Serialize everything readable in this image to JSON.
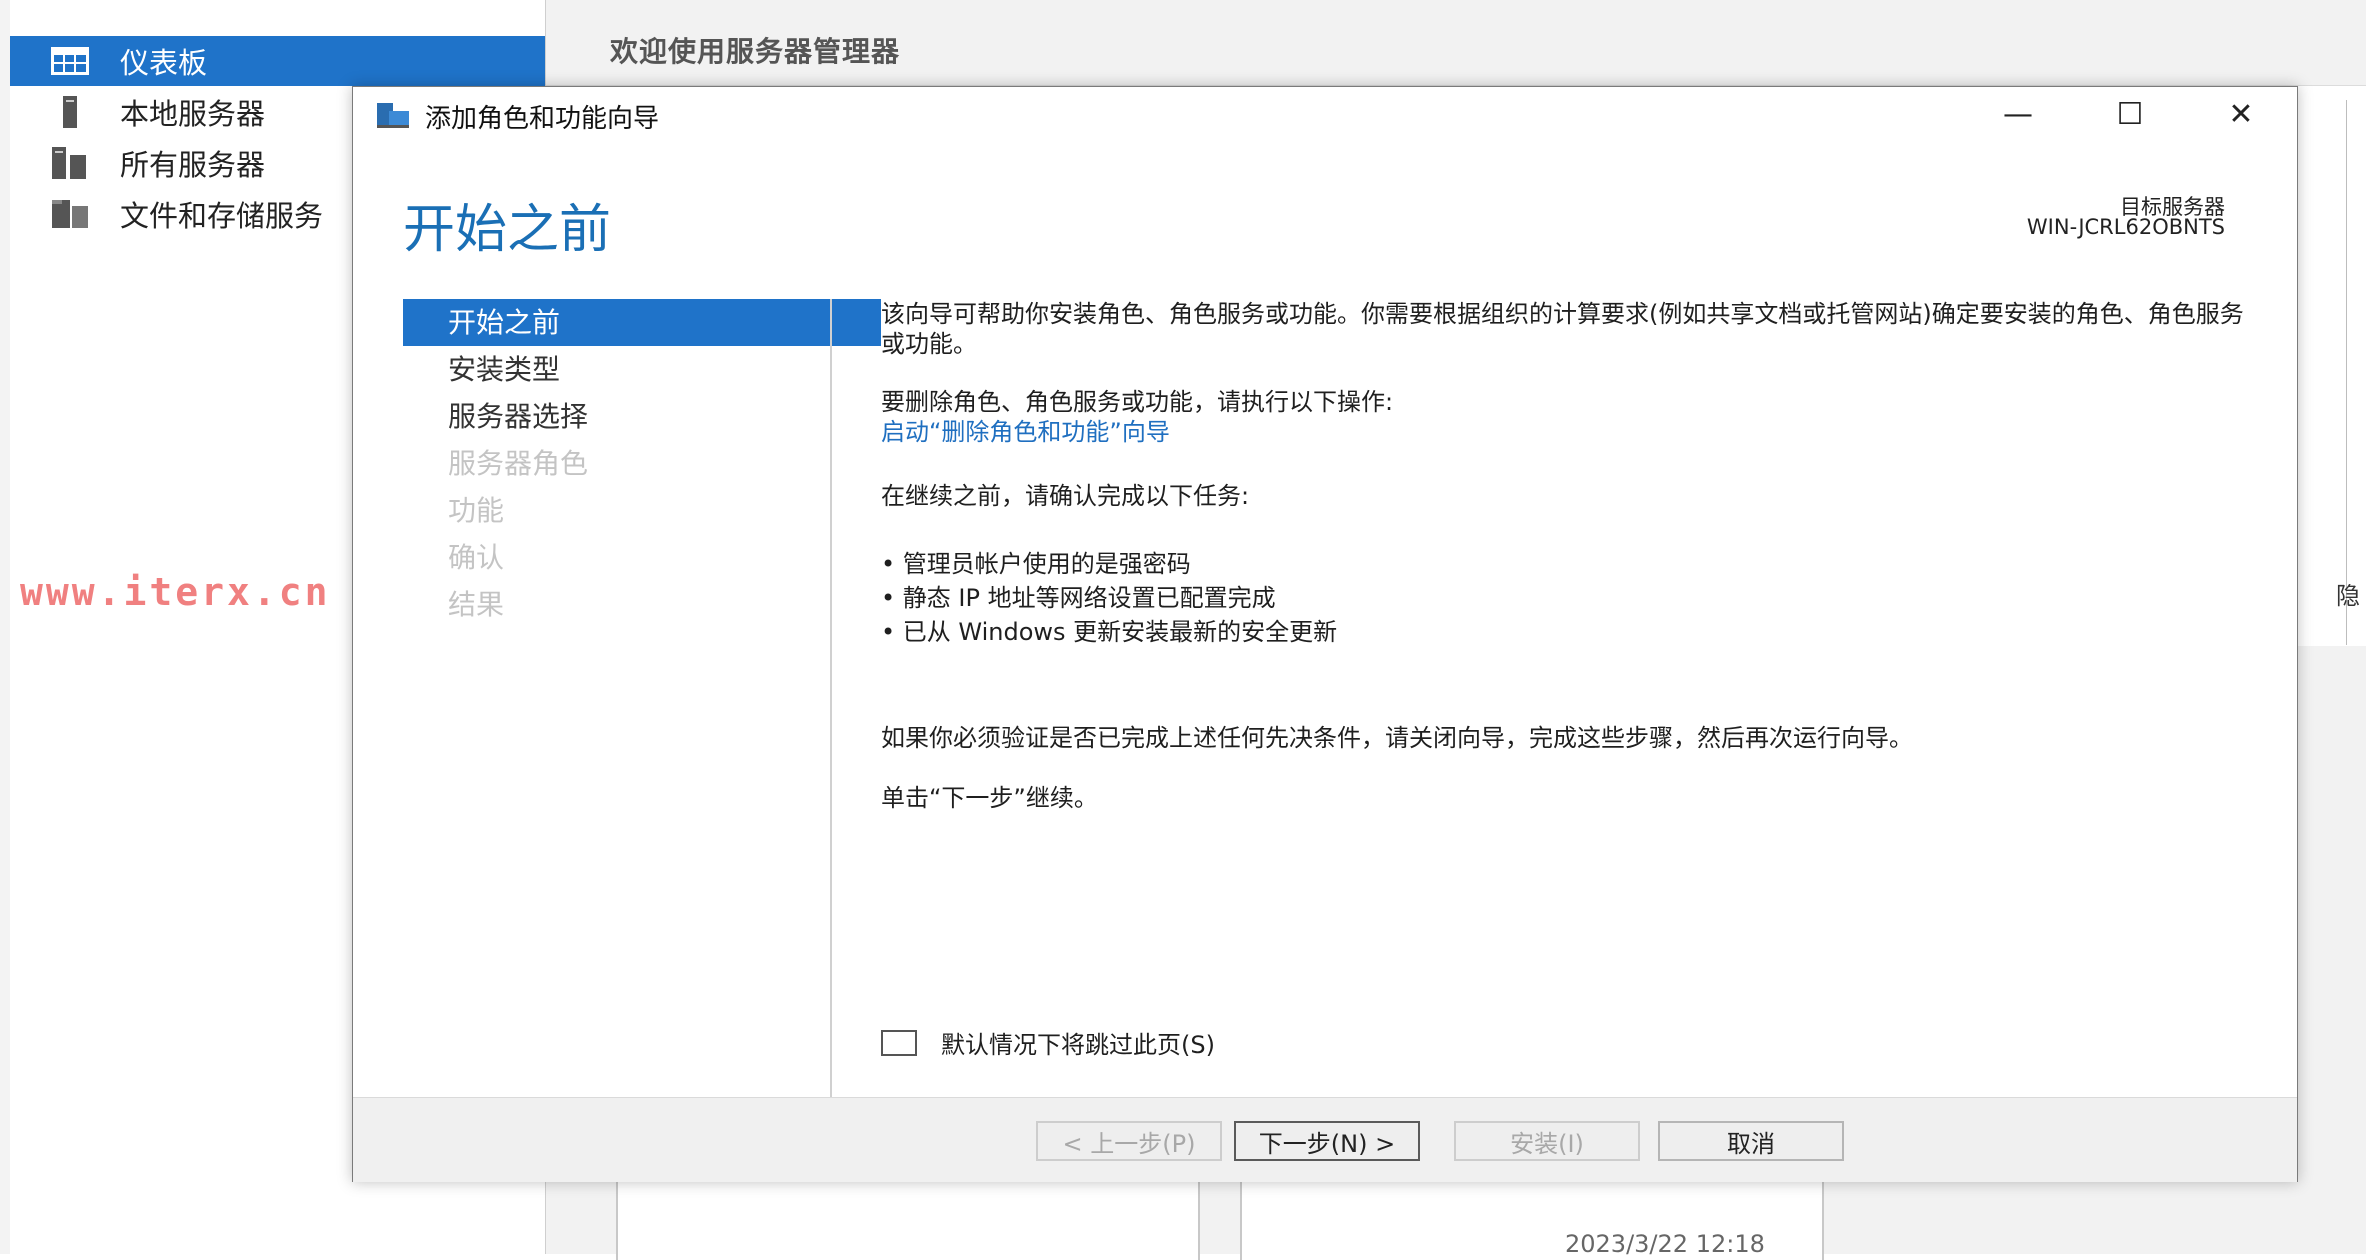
{
  "server_manager": {
    "welcome_title": "欢迎使用服务器管理器",
    "sidebar": {
      "items": [
        {
          "label": "仪表板",
          "icon": "dashboard-icon",
          "active": true
        },
        {
          "label": "本地服务器",
          "icon": "local-server-icon",
          "active": false
        },
        {
          "label": "所有服务器",
          "icon": "all-servers-icon",
          "active": false
        },
        {
          "label": "文件和存储服务",
          "icon": "file-storage-icon",
          "active": false
        }
      ]
    },
    "right_hint": "隐",
    "timestamp": "2023/3/22 12:18"
  },
  "watermark": "www.iterx.cn",
  "wizard": {
    "title": "添加角色和功能向导",
    "window_controls": {
      "minimize": "—",
      "maximize": "☐",
      "close": "✕"
    },
    "heading": "开始之前",
    "target_server_label": "目标服务器",
    "target_server_name": "WIN-JCRL62OBNTS",
    "steps": [
      {
        "label": "开始之前",
        "state": "current"
      },
      {
        "label": "安装类型",
        "state": "enabled"
      },
      {
        "label": "服务器选择",
        "state": "enabled"
      },
      {
        "label": "服务器角色",
        "state": "disabled"
      },
      {
        "label": "功能",
        "state": "disabled"
      },
      {
        "label": "确认",
        "state": "disabled"
      },
      {
        "label": "结果",
        "state": "disabled"
      }
    ],
    "content": {
      "intro": "该向导可帮助你安装角色、角色服务或功能。你需要根据组织的计算要求(例如共享文档或托管网站)确定要安装的角色、角色服务或功能。",
      "remove_text": "要删除角色、角色服务或功能，请执行以下操作:",
      "remove_link": "启动“删除角色和功能”向导",
      "confirm_text": "在继续之前，请确认完成以下任务:",
      "bullets": [
        "管理员帐户使用的是强密码",
        "静态 IP 地址等网络设置已配置完成",
        "已从 Windows 更新安装最新的安全更新"
      ],
      "verify_text": "如果你必须验证是否已完成上述任何先决条件，请关闭向导，完成这些步骤，然后再次运行向导。",
      "continue_text": "单击“下一步”继续。"
    },
    "skip_checkbox_label": "默认情况下将跳过此页(S)",
    "skip_checked": false,
    "buttons": {
      "prev": "< 上一步(P)",
      "next": "下一步(N) >",
      "install": "安装(I)",
      "cancel": "取消"
    },
    "colors": {
      "accent": "#1f73c9",
      "heading": "#1a6fb5",
      "link": "#1f6fc0"
    }
  }
}
